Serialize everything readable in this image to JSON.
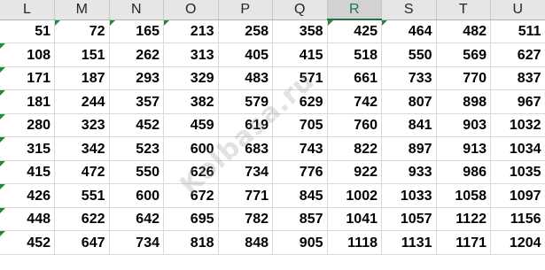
{
  "sheet": {
    "columns": [
      "L",
      "M",
      "N",
      "O",
      "P",
      "Q",
      "R",
      "S",
      "T",
      "U"
    ],
    "selected_column": "R",
    "rows": [
      [
        51,
        72,
        165,
        213,
        258,
        358,
        425,
        464,
        482,
        511
      ],
      [
        108,
        151,
        262,
        313,
        405,
        415,
        518,
        550,
        569,
        627
      ],
      [
        171,
        187,
        293,
        329,
        483,
        571,
        661,
        733,
        770,
        837
      ],
      [
        181,
        244,
        357,
        382,
        579,
        629,
        742,
        807,
        898,
        967
      ],
      [
        280,
        323,
        452,
        459,
        619,
        705,
        760,
        841,
        903,
        1032
      ],
      [
        315,
        342,
        523,
        600,
        683,
        743,
        822,
        897,
        913,
        1034
      ],
      [
        415,
        472,
        550,
        626,
        734,
        776,
        922,
        933,
        986,
        1035
      ],
      [
        426,
        551,
        600,
        672,
        771,
        845,
        1002,
        1033,
        1058,
        1097
      ],
      [
        448,
        622,
        642,
        695,
        782,
        857,
        1041,
        1057,
        1122,
        1156
      ],
      [
        452,
        647,
        734,
        818,
        848,
        905,
        1118,
        1131,
        1171,
        1204
      ]
    ],
    "error_indicator_cells": [
      [
        0,
        1
      ],
      [
        0,
        2
      ],
      [
        0,
        3
      ],
      [
        0,
        6
      ],
      [
        0,
        7
      ],
      [
        1,
        0
      ],
      [
        2,
        0
      ],
      [
        3,
        0
      ],
      [
        4,
        0
      ],
      [
        5,
        0
      ],
      [
        6,
        0
      ],
      [
        7,
        0
      ],
      [
        8,
        0
      ],
      [
        9,
        0
      ]
    ]
  },
  "watermark": {
    "text": "Kolbasa.ru"
  },
  "colors": {
    "accent": "#217346",
    "error_indicator": "#1e8a3a",
    "header_bg": "#e6e6e6",
    "gridline": "#d9d9d9"
  }
}
